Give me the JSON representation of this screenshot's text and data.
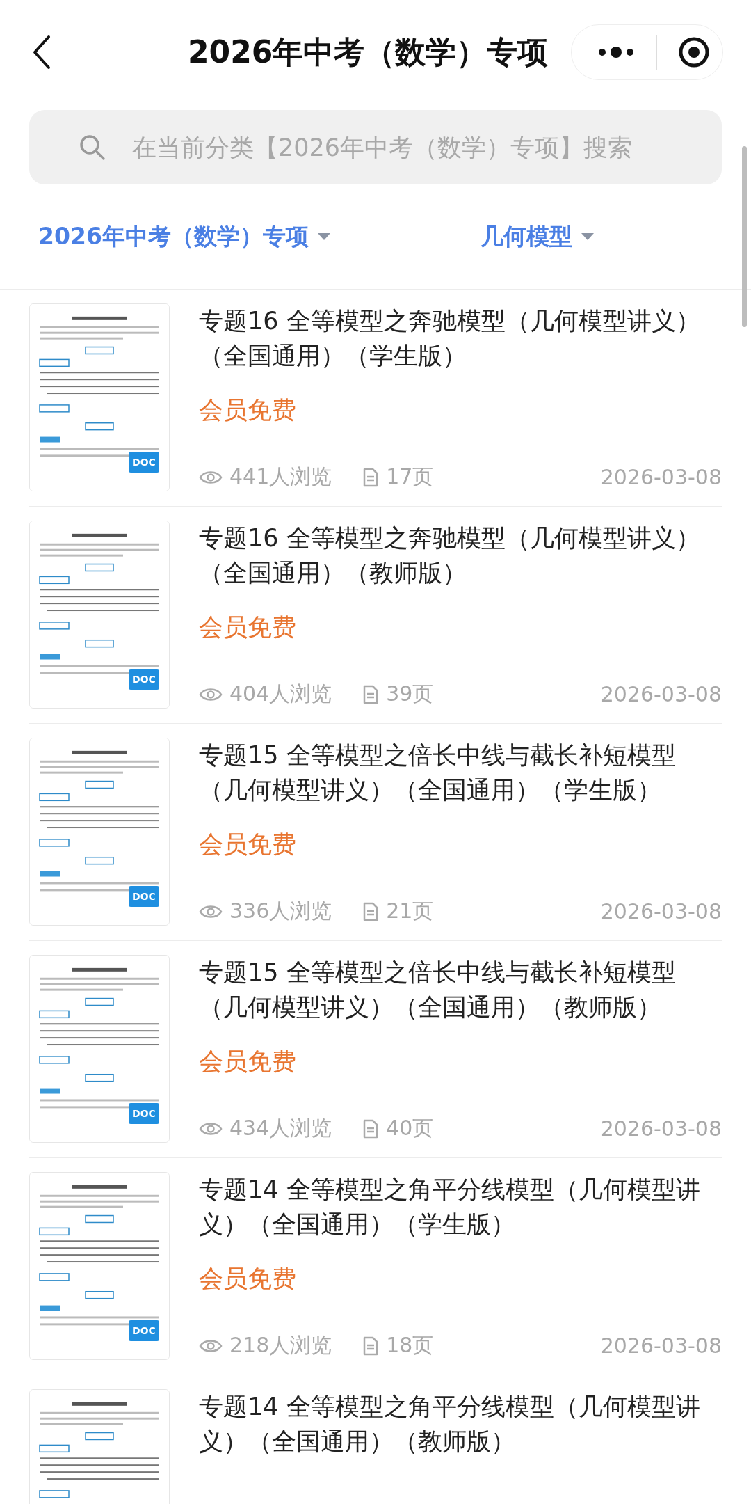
{
  "nav": {
    "title": "2026年中考（数学）专项"
  },
  "search": {
    "placeholder": "在当前分类【2026年中考（数学）专项】搜索"
  },
  "filters": [
    {
      "label": "2026年中考（数学）专项"
    },
    {
      "label": "几何模型"
    }
  ],
  "items": [
    {
      "title": "专题16 全等模型之奔驰模型（几何模型讲义）（全国通用）（学生版）",
      "price": "会员免费",
      "badge": "DOC",
      "views": "441人浏览",
      "pages": "17页",
      "date": "2026-03-08"
    },
    {
      "title": "专题16 全等模型之奔驰模型（几何模型讲义）（全国通用）（教师版）",
      "price": "会员免费",
      "badge": "DOC",
      "views": "404人浏览",
      "pages": "39页",
      "date": "2026-03-08"
    },
    {
      "title": "专题15 全等模型之倍长中线与截长补短模型（几何模型讲义）（全国通用）（学生版）",
      "price": "会员免费",
      "badge": "DOC",
      "views": "336人浏览",
      "pages": "21页",
      "date": "2026-03-08"
    },
    {
      "title": "专题15 全等模型之倍长中线与截长补短模型（几何模型讲义）（全国通用）（教师版）",
      "price": "会员免费",
      "badge": "DOC",
      "views": "434人浏览",
      "pages": "40页",
      "date": "2026-03-08"
    },
    {
      "title": "专题14 全等模型之角平分线模型（几何模型讲义）（全国通用）（学生版）",
      "price": "会员免费",
      "badge": "DOC",
      "views": "218人浏览",
      "pages": "18页",
      "date": "2026-03-08"
    },
    {
      "title": "专题14 全等模型之角平分线模型（几何模型讲义）（全国通用）（教师版）"
    }
  ]
}
